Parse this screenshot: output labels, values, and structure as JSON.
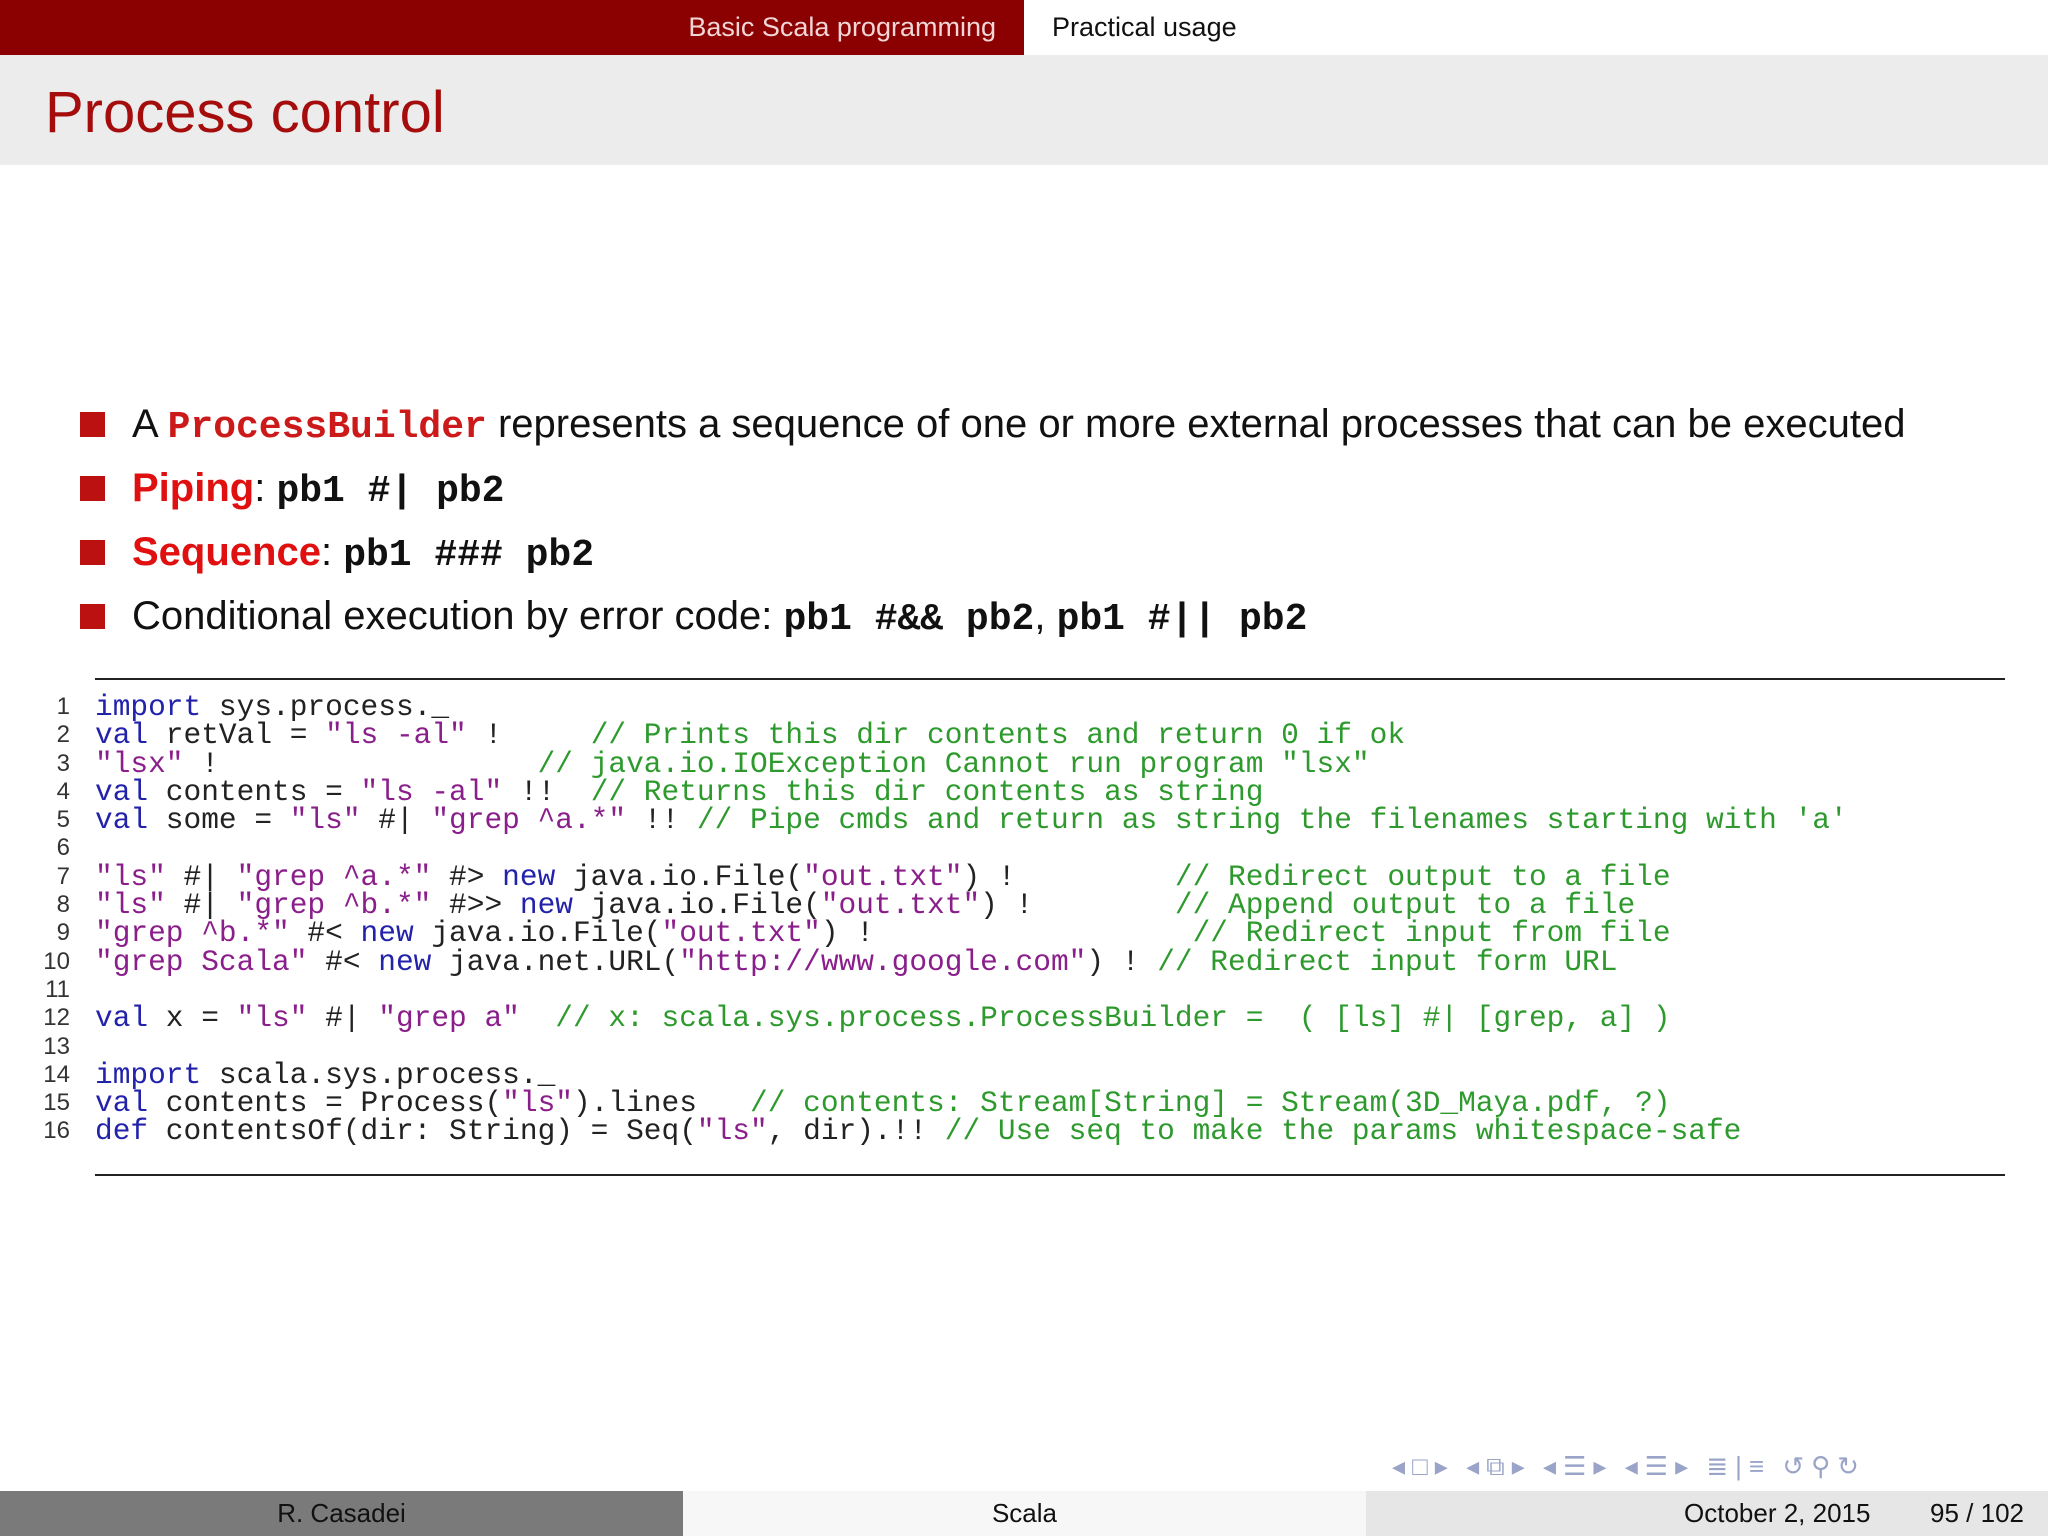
{
  "nav": {
    "section_left": "Basic Scala programming",
    "section_right": "Practical usage"
  },
  "slide": {
    "title": "Process control"
  },
  "bullets": {
    "b1": {
      "pre": "A ",
      "code": "ProcessBuilder",
      "post": " represents a sequence of one or more external processes that can be executed"
    },
    "b2": {
      "label": "Piping",
      "colon": ": ",
      "code": "pb1 #| pb2"
    },
    "b3": {
      "label": "Sequence",
      "colon": ": ",
      "code": "pb1 ### pb2"
    },
    "b4": {
      "pre": "Conditional execution by error code: ",
      "code1": "pb1 #&& pb2",
      "sep": ", ",
      "code2": "pb1 #|| pb2"
    }
  },
  "code_lines": [
    {
      "n": "1",
      "parts": [
        {
          "k": "kw",
          "t": "import"
        },
        {
          "k": "pl",
          "t": " sys.process._"
        }
      ]
    },
    {
      "n": "2",
      "parts": [
        {
          "k": "kw",
          "t": "val"
        },
        {
          "k": "pl",
          "t": " retVal = "
        },
        {
          "k": "st",
          "t": "\"ls -al\""
        },
        {
          "k": "pl",
          "t": " !     "
        },
        {
          "k": "cm",
          "t": "// Prints this dir contents and return 0 if ok"
        }
      ]
    },
    {
      "n": "3",
      "parts": [
        {
          "k": "st",
          "t": "\"lsx\""
        },
        {
          "k": "pl",
          "t": " !                  "
        },
        {
          "k": "cm",
          "t": "// java.io.IOException Cannot run program \"lsx\""
        }
      ]
    },
    {
      "n": "4",
      "parts": [
        {
          "k": "kw",
          "t": "val"
        },
        {
          "k": "pl",
          "t": " contents = "
        },
        {
          "k": "st",
          "t": "\"ls -al\""
        },
        {
          "k": "pl",
          "t": " !!  "
        },
        {
          "k": "cm",
          "t": "// Returns this dir contents as string"
        }
      ]
    },
    {
      "n": "5",
      "parts": [
        {
          "k": "kw",
          "t": "val"
        },
        {
          "k": "pl",
          "t": " some = "
        },
        {
          "k": "st",
          "t": "\"ls\""
        },
        {
          "k": "pl",
          "t": " #| "
        },
        {
          "k": "st",
          "t": "\"grep ^a.*\""
        },
        {
          "k": "pl",
          "t": " !! "
        },
        {
          "k": "cm",
          "t": "// Pipe cmds and return as string the filenames starting with 'a'"
        }
      ]
    },
    {
      "n": "6",
      "parts": []
    },
    {
      "n": "7",
      "parts": [
        {
          "k": "st",
          "t": "\"ls\""
        },
        {
          "k": "pl",
          "t": " #| "
        },
        {
          "k": "st",
          "t": "\"grep ^a.*\""
        },
        {
          "k": "pl",
          "t": " #> "
        },
        {
          "k": "kw",
          "t": "new"
        },
        {
          "k": "pl",
          "t": " java.io.File("
        },
        {
          "k": "st",
          "t": "\"out.txt\""
        },
        {
          "k": "pl",
          "t": ") !         "
        },
        {
          "k": "cm",
          "t": "// Redirect output to a file"
        }
      ]
    },
    {
      "n": "8",
      "parts": [
        {
          "k": "st",
          "t": "\"ls\""
        },
        {
          "k": "pl",
          "t": " #| "
        },
        {
          "k": "st",
          "t": "\"grep ^b.*\""
        },
        {
          "k": "pl",
          "t": " #>> "
        },
        {
          "k": "kw",
          "t": "new"
        },
        {
          "k": "pl",
          "t": " java.io.File("
        },
        {
          "k": "st",
          "t": "\"out.txt\""
        },
        {
          "k": "pl",
          "t": ") !        "
        },
        {
          "k": "cm",
          "t": "// Append output to a file"
        }
      ]
    },
    {
      "n": "9",
      "parts": [
        {
          "k": "st",
          "t": "\"grep ^b.*\""
        },
        {
          "k": "pl",
          "t": " #< "
        },
        {
          "k": "kw",
          "t": "new"
        },
        {
          "k": "pl",
          "t": " java.io.File("
        },
        {
          "k": "st",
          "t": "\"out.txt\""
        },
        {
          "k": "pl",
          "t": ") !                  "
        },
        {
          "k": "cm",
          "t": "// Redirect input from file"
        }
      ]
    },
    {
      "n": "10",
      "parts": [
        {
          "k": "st",
          "t": "\"grep Scala\""
        },
        {
          "k": "pl",
          "t": " #< "
        },
        {
          "k": "kw",
          "t": "new"
        },
        {
          "k": "pl",
          "t": " java.net.URL("
        },
        {
          "k": "st",
          "t": "\"http://www.google.com\""
        },
        {
          "k": "pl",
          "t": ") ! "
        },
        {
          "k": "cm",
          "t": "// Redirect input form URL"
        }
      ]
    },
    {
      "n": "11",
      "parts": []
    },
    {
      "n": "12",
      "parts": [
        {
          "k": "kw",
          "t": "val"
        },
        {
          "k": "pl",
          "t": " x = "
        },
        {
          "k": "st",
          "t": "\"ls\""
        },
        {
          "k": "pl",
          "t": " #| "
        },
        {
          "k": "st",
          "t": "\"grep a\""
        },
        {
          "k": "pl",
          "t": "  "
        },
        {
          "k": "cm",
          "t": "// x: scala.sys.process.ProcessBuilder =  ( [ls] #| [grep, a] )"
        }
      ]
    },
    {
      "n": "13",
      "parts": []
    },
    {
      "n": "14",
      "parts": [
        {
          "k": "kw",
          "t": "import"
        },
        {
          "k": "pl",
          "t": " scala.sys.process._"
        }
      ]
    },
    {
      "n": "15",
      "parts": [
        {
          "k": "kw",
          "t": "val"
        },
        {
          "k": "pl",
          "t": " contents = Process("
        },
        {
          "k": "st",
          "t": "\"ls\""
        },
        {
          "k": "pl",
          "t": ").lines   "
        },
        {
          "k": "cm",
          "t": "// contents: Stream[String] = Stream(3D_Maya.pdf, ?)"
        }
      ]
    },
    {
      "n": "16",
      "parts": [
        {
          "k": "kw",
          "t": "def"
        },
        {
          "k": "pl",
          "t": " contentsOf(dir: String) = Seq("
        },
        {
          "k": "st",
          "t": "\"ls\""
        },
        {
          "k": "pl",
          "t": ", dir).!! "
        },
        {
          "k": "cm",
          "t": "// Use seq to make the params whitespace-safe"
        }
      ]
    }
  ],
  "colors": {
    "nav_bar": "#8b0000",
    "title": "#a50d0d",
    "bullet": "#bb1111",
    "keyword": "#2222aa",
    "string": "#8a1e8a",
    "comment": "#2e9a2e"
  },
  "nav_symbols": {
    "frame_prev": "◂",
    "frame_icon": "□",
    "frame_next": "▸",
    "sub_prev": "◂",
    "sub_icon": "⧉",
    "sub_next": "▸",
    "sec_prev": "◂",
    "sec_icon": "☰",
    "sec_next": "▸",
    "ssec_prev": "◂",
    "ssec_icon": "☰",
    "ssec_next": "▸",
    "doc_icon": "≣",
    "sep": "|",
    "pres_icon": "≡",
    "undo": "↺",
    "search": "⚲",
    "redo": "↻"
  },
  "footer": {
    "author": "R. Casadei",
    "title": "Scala",
    "date": "October 2, 2015",
    "page": "95 / 102"
  }
}
